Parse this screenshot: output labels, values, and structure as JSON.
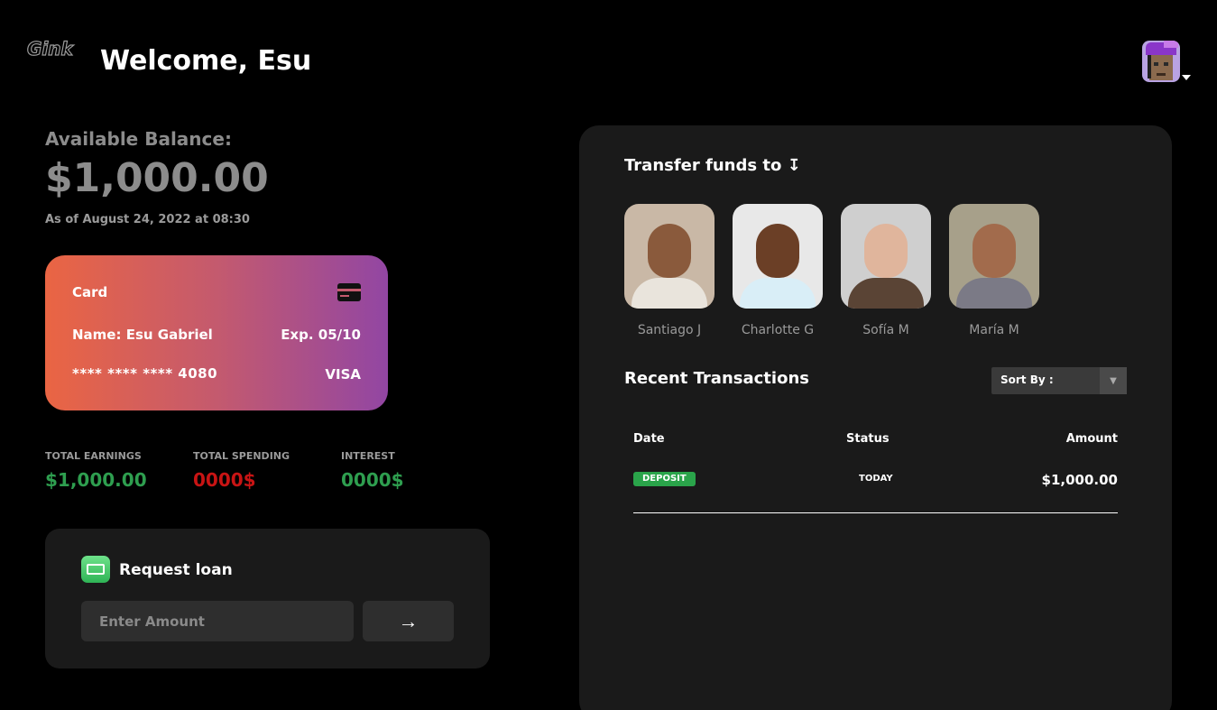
{
  "header": {
    "logo": "Gink",
    "welcome": "Welcome, Esu"
  },
  "balance": {
    "label": "Available Balance:",
    "amount": "$1,000.00",
    "as_of": "As of August 24, 2022 at 08:30"
  },
  "card": {
    "title": "Card",
    "name": "Name: Esu Gabriel",
    "expiry": "Exp. 05/10",
    "number": "**** **** **** 4080",
    "brand": "VISA",
    "icon": "credit-card-icon",
    "gradient": [
      "#ea6543",
      "#9246a3"
    ]
  },
  "stats": [
    {
      "label": "TOTAL EARNINGS",
      "value": "$1,000.00",
      "color": "#2e9e4f"
    },
    {
      "label": "TOTAL SPENDING",
      "value": "0000$",
      "color": "#c81414"
    },
    {
      "label": "INTEREST",
      "value": "0000$",
      "color": "#2e9e4f"
    }
  ],
  "loan": {
    "title": "Request loan",
    "placeholder": "Enter Amount",
    "submit_icon": "arrow-right-icon",
    "submit_glyph": "→"
  },
  "transfer": {
    "title": "Transfer funds to ↧",
    "contacts": [
      {
        "name": "Santiago J",
        "skin": "#8a5a3c",
        "bg": "#c9b8a6",
        "cloth": "#e9e4dc"
      },
      {
        "name": "Charlotte G",
        "skin": "#6b3f26",
        "bg": "#e8e8e8",
        "cloth": "#d9eef7"
      },
      {
        "name": "Sofía M",
        "skin": "#e0b59c",
        "bg": "#cfcfcf",
        "cloth": "#5a4435"
      },
      {
        "name": "María M",
        "skin": "#a26b4c",
        "bg": "#a7a08a",
        "cloth": "#7b7a86"
      }
    ]
  },
  "transactions": {
    "title": "Recent Transactions",
    "sort_label": "Sort By :",
    "sort_arrow": "▼",
    "columns": {
      "date": "Date",
      "status": "Status",
      "amount": "Amount"
    },
    "rows": [
      {
        "type": "DEPOSIT",
        "status": "TODAY",
        "amount": "$1,000.00"
      }
    ]
  }
}
